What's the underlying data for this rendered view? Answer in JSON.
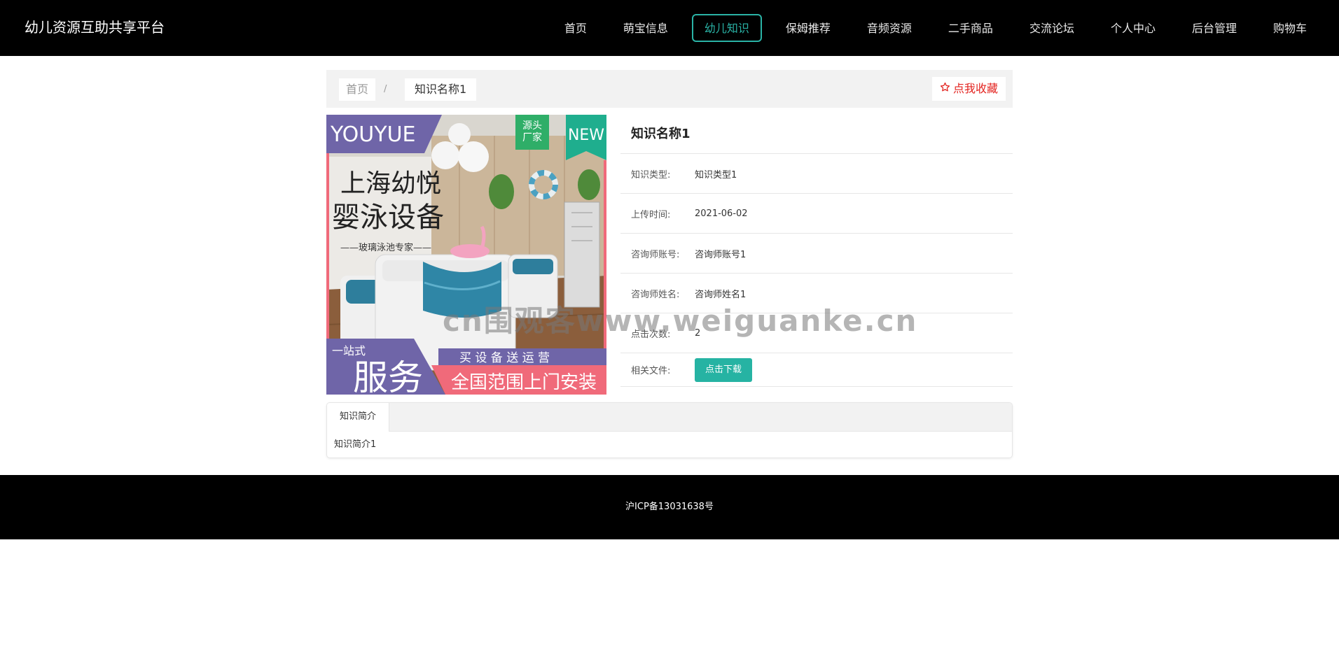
{
  "header": {
    "brand": "幼儿资源互助共享平台",
    "nav": [
      {
        "label": "首页"
      },
      {
        "label": "萌宝信息"
      },
      {
        "label": "幼儿知识",
        "active": true
      },
      {
        "label": "保姆推荐"
      },
      {
        "label": "音频资源"
      },
      {
        "label": "二手商品"
      },
      {
        "label": "交流论坛"
      },
      {
        "label": "个人中心"
      },
      {
        "label": "后台管理"
      },
      {
        "label": "购物车"
      }
    ],
    "accent_color": "#2ab3a6"
  },
  "breadcrumb": {
    "home": "首页",
    "separator": "/",
    "current": "知识名称1"
  },
  "favorite": {
    "icon": "star-outline-icon",
    "label": "点我收藏",
    "color": "#e3231f"
  },
  "cover": {
    "brand_text": "YOUYUE",
    "badge_factory": "源头厂家",
    "badge_new": "NEW",
    "headline_1": "上海幼悦",
    "headline_2": "婴泳设备",
    "tagline": "——玻璃泳池专家——",
    "bottom_small": "一站式",
    "bottom_big": "服务",
    "promo_1": "买 设 备 送 运 营",
    "promo_2": "全国范围上门安装"
  },
  "detail": {
    "title": "知识名称1",
    "rows": [
      {
        "label": "知识类型:",
        "value": "知识类型1"
      },
      {
        "label": "上传时间:",
        "value": "2021-06-02"
      },
      {
        "label": "咨询师账号:",
        "value": "咨询师账号1"
      },
      {
        "label": "咨询师姓名:",
        "value": "咨询师姓名1"
      },
      {
        "label": "点击次数:",
        "value": "2"
      }
    ],
    "file_label": "相关文件:",
    "download_label": "点击下载",
    "download_color": "#26b3a3"
  },
  "tabs": {
    "active_label": "知识简介",
    "content": "知识简介1"
  },
  "footer": {
    "icp": "沪ICP备13031638号"
  },
  "watermark": "cn围观客www.weiguanke.cn"
}
